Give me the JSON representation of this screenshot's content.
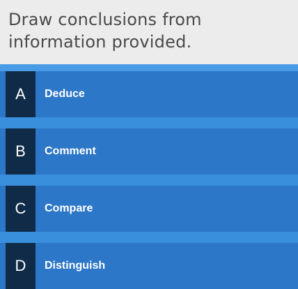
{
  "question": {
    "text": "Draw conclusions from information provided."
  },
  "options": [
    {
      "letter": "A",
      "label": "Deduce"
    },
    {
      "letter": "B",
      "label": "Comment"
    },
    {
      "letter": "C",
      "label": "Compare"
    },
    {
      "letter": "D",
      "label": "Distinguish"
    }
  ],
  "colors": {
    "question_background": "#ececec",
    "question_text": "#4a4a4a",
    "answers_background": "#4a9be6",
    "option_background": "#2d77c8",
    "letter_box": "#0f2b48",
    "option_text": "#ffffff"
  }
}
